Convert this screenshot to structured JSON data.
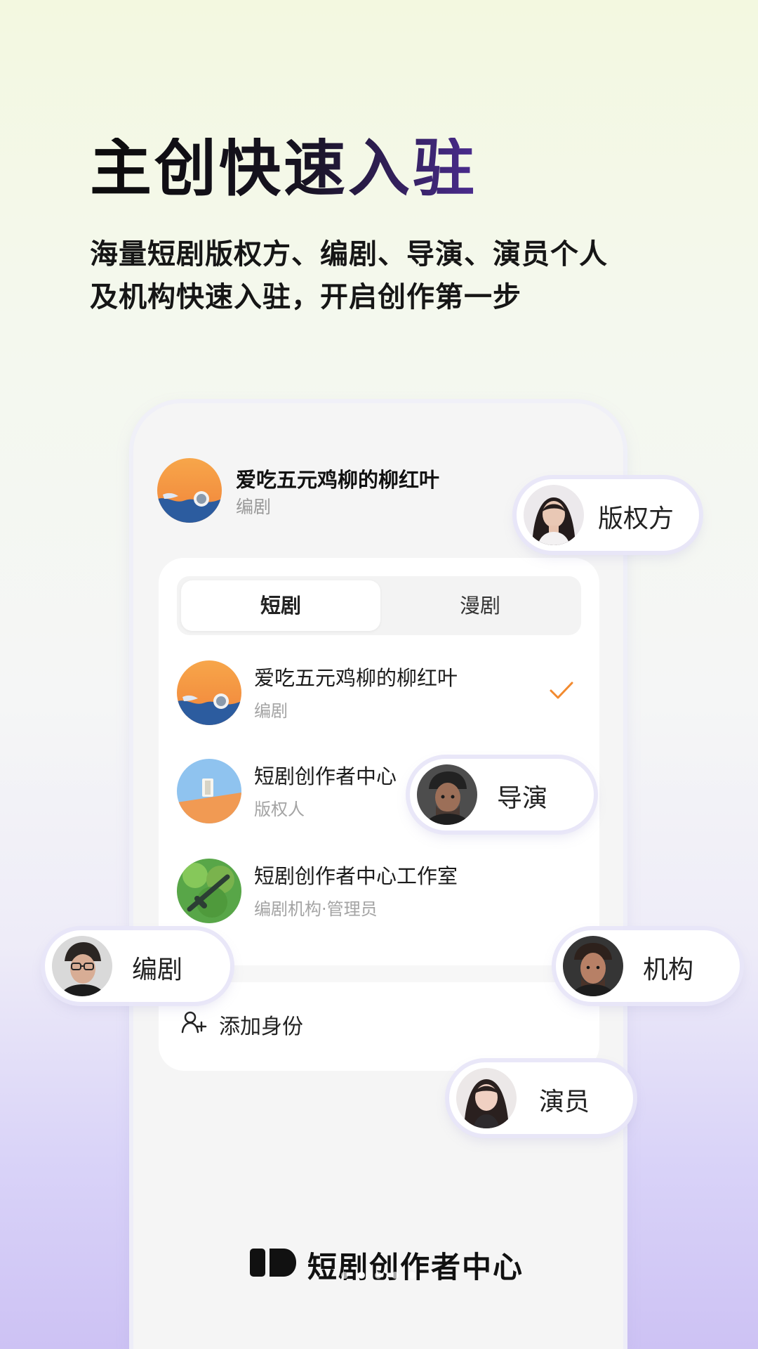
{
  "hero": {
    "title": "主创快速入驻",
    "subtitle_line1": "海量短剧版权方、编剧、导演、演员个人",
    "subtitle_line2": "及机构快速入驻，开启创作第一步"
  },
  "phone": {
    "current_user": {
      "name": "爱吃五元鸡柳的柳红叶",
      "role": "编剧"
    },
    "tabs": [
      {
        "label": "短剧",
        "active": true
      },
      {
        "label": "漫剧",
        "active": false
      }
    ],
    "identities": [
      {
        "title": "爱吃五元鸡柳的柳红叶",
        "subtitle": "编剧",
        "selected": true
      },
      {
        "title": "短剧创作者中心",
        "subtitle": "版权人",
        "selected": false
      },
      {
        "title": "短剧创作者中心工作室",
        "subtitle": "编剧机构·管理员",
        "selected": false
      }
    ],
    "add_identity_label": "添加身份"
  },
  "floating_roles": {
    "copyright": "版权方",
    "director": "导演",
    "writer": "编剧",
    "organization": "机构",
    "actor": "演员"
  },
  "brand": {
    "name": "短剧创作者中心"
  },
  "carousel": {
    "total": 5,
    "active_index": 1
  },
  "colors": {
    "accent_orange": "#f28a2f",
    "brand_purple": "#4b2c8f"
  },
  "icons": {
    "check": "check-icon",
    "add_user": "add-user-icon",
    "brand_logo": "brand-logo-icon"
  }
}
